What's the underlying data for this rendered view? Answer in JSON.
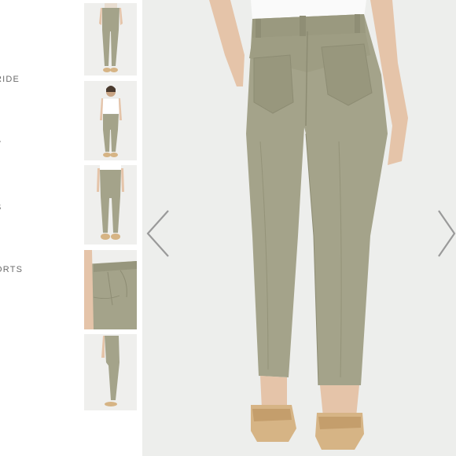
{
  "nav": {
    "items": [
      {
        "label": "RIDE"
      },
      {
        "label": "Y"
      },
      {
        "label": "S"
      },
      {
        "label": "ORTS"
      }
    ]
  },
  "gallery": {
    "thumbnail_count": 5,
    "selected_index": 0
  },
  "colors": {
    "pants": "#a4a38a",
    "pants_shadow": "#8d8c73",
    "background": "#edeeec",
    "skin": "#e5c4a9",
    "shoe": "#d6b485",
    "arrow": "#9a9a9a"
  },
  "icons": {
    "prev": "chevron-left-icon",
    "next": "chevron-right-icon"
  }
}
